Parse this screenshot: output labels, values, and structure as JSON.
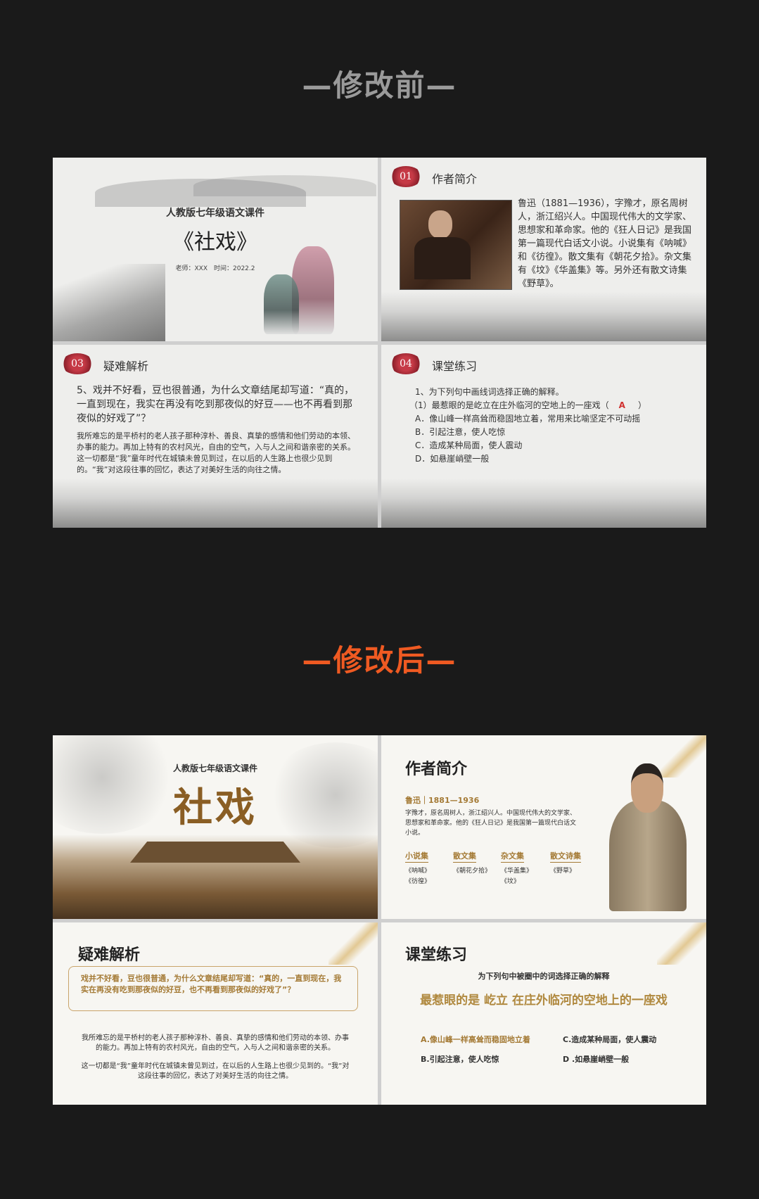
{
  "before_title": "—修改前—",
  "after_title": "—修改后—",
  "before": {
    "cover": {
      "subtitle": "人教版七年级语文课件",
      "title": "《社戏》",
      "meta": "老师：XXX　时间：2022.2"
    },
    "author": {
      "badge": "01",
      "heading": "作者简介",
      "text": "鲁迅（1881—1936），字豫才，原名周树人，浙江绍兴人。中国现代伟大的文学家、思想家和革命家。他的《狂人日记》是我国第一篇现代白话文小说。小说集有《呐喊》和《彷徨》。散文集有《朝花夕拾》。杂文集有《坟》《华盖集》等。另外还有散文诗集《野草》。"
    },
    "analysis": {
      "badge": "03",
      "heading": "疑难解析",
      "question": "5、戏并不好看，豆也很普通，为什么文章结尾却写道：“真的，一直到现在，我实在再没有吃到那夜似的好豆——也不再看到那夜似的好戏了”？",
      "answer": "我所难忘的是平桥村的老人孩子那种淳朴、善良、真挚的感情和他们劳动的本领、办事的能力。再加上特有的农村风光，自由的空气，入与人之间和谐亲密的关系。这一切都是“我”童年时代在城镇未曾见到过，在以后的人生路上也很少见到的。“我”对这段往事的回忆，表达了对美好生活的向往之情。"
    },
    "practice": {
      "badge": "04",
      "heading": "课堂练习",
      "lines": [
        "1、为下列句中画线词选择正确的解释。",
        "（1）最惹眼的是屹立在庄外临河的空地上的一座戏（",
        "A．像山峰一样高耸而稳固地立着，常用来比喻坚定不可动摇",
        "B．引起注意，使人吃惊",
        "C．造成某种局面，使人震动",
        "D．如悬崖峭壁一般"
      ],
      "answer": "A",
      "close_paren": "）"
    }
  },
  "after": {
    "cover": {
      "subtitle": "人教版七年级语文课件",
      "title": "社戏"
    },
    "author": {
      "heading": "作者简介",
      "name_line": "鲁迅｜1881—1936",
      "bio": "字豫才，原名周树人，浙江绍兴人。中国现代伟大的文学家、思想家和革命家。他的《狂人日记》是我国第一篇现代白话文小说。",
      "categories": [
        {
          "label": "小说集",
          "works": "《呐喊》\n《彷徨》"
        },
        {
          "label": "散文集",
          "works": "《朝花夕拾》"
        },
        {
          "label": "杂文集",
          "works": "《华盖集》\n《坟》"
        },
        {
          "label": "散文诗集",
          "works": "《野草》"
        }
      ]
    },
    "analysis": {
      "heading": "疑难解析",
      "question": "戏并不好看，豆也很普通，为什么文章结尾却写道：“真的，一直到现在，我实在再没有吃到那夜似的好豆，也不再看到那夜似的好戏了”？",
      "answer1": "我所难忘的是平桥村的老人孩子那种淳朴、善良、真挚的感情和他们劳动的本领、办事的能力。再加上特有的农村风光，自由的空气，入与人之间和谐亲密的关系。",
      "answer2": "这一切都是“我”童年时代在城镇未曾见到过，在以后的人生路上也很少见到的。“我”对这段往事的回忆，表达了对美好生活的向往之情。"
    },
    "practice": {
      "heading": "课堂练习",
      "instruction": "为下列句中被圈中的词选择正确的解释",
      "sentence": "最惹眼的是 屹立 在庄外临河的空地上的一座戏",
      "options": {
        "a": "A.像山峰一样高耸而稳固地立着",
        "b": "B.引起注意，使人吃惊",
        "c": "C.造成某种局面，使人震动",
        "d": "D .如悬崖峭壁一般"
      }
    }
  }
}
